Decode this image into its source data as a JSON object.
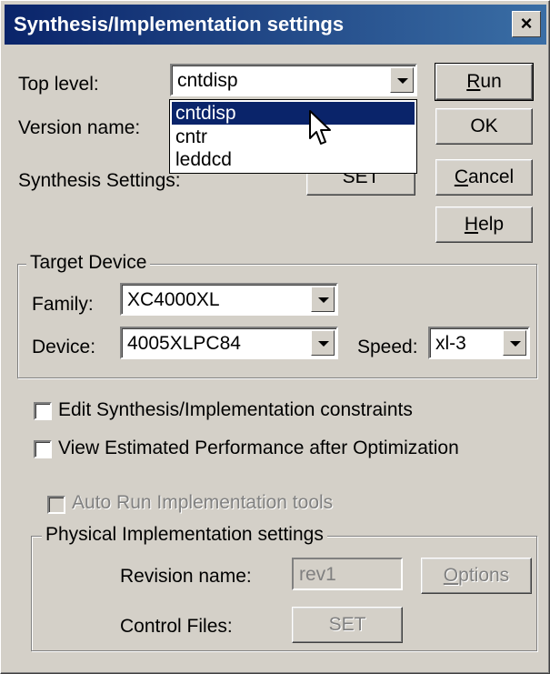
{
  "window": {
    "title": "Synthesis/Implementation settings",
    "close_glyph": "×"
  },
  "form": {
    "top_level_label": "Top level:",
    "top_level_value": "cntdisp",
    "version_name_label": "Version name:",
    "synthesis_settings_label": "Synthesis Settings:",
    "synthesis_set_button": "SET"
  },
  "dropdown": {
    "options": [
      "cntdisp",
      "cntr",
      "leddcd"
    ],
    "selected": "cntdisp"
  },
  "buttons": {
    "run": {
      "mnemonic": "R",
      "rest": "un"
    },
    "ok": "OK",
    "cancel": {
      "mnemonic": "C",
      "rest": "ancel"
    },
    "help": {
      "mnemonic": "H",
      "rest": "elp"
    }
  },
  "target_device": {
    "legend": "Target Device",
    "family_label": "Family:",
    "family_value": "XC4000XL",
    "device_label": "Device:",
    "device_value": "4005XLPC84",
    "speed_label": "Speed:",
    "speed_value": "xl-3"
  },
  "options": {
    "edit_constraints": "Edit Synthesis/Implementation constraints",
    "view_performance": "View Estimated Performance after Optimization",
    "auto_run": "Auto Run Implementation tools"
  },
  "physical": {
    "legend": "Physical Implementation settings",
    "revision_label": "Revision name:",
    "revision_value": "rev1",
    "options_button": {
      "mnemonic": "O",
      "rest": "ptions"
    },
    "control_files_label": "Control Files:",
    "control_set_button": "SET"
  },
  "colors": {
    "title_bar": "#0a246a",
    "face": "#d4d0c8",
    "highlight": "#0a246a"
  },
  "icons": {
    "cursor": "arrow-cursor-icon"
  }
}
